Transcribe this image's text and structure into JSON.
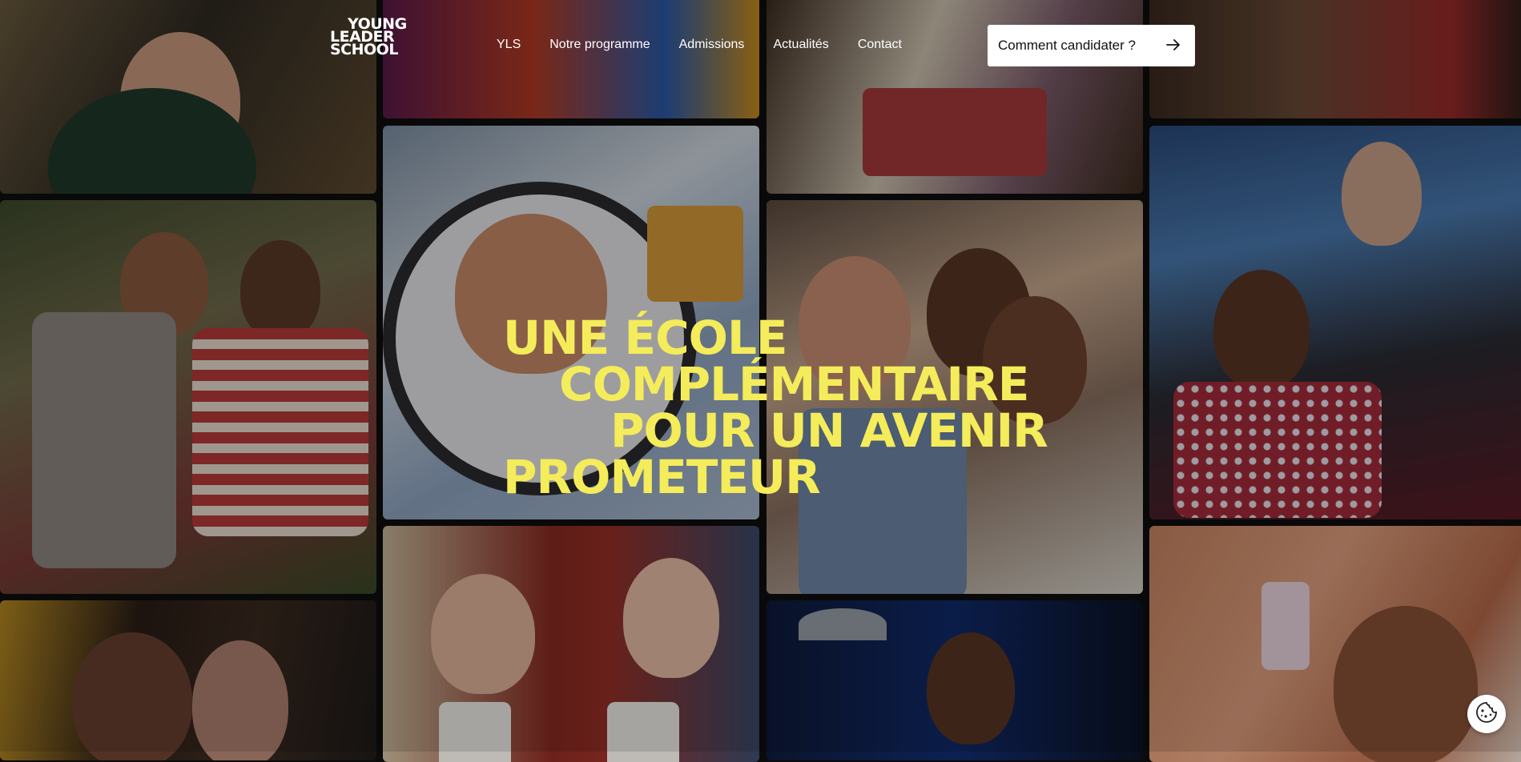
{
  "logo": {
    "line1": "YOUNG",
    "line2": "LEADER",
    "line3": "SCHOOL"
  },
  "nav": {
    "items": [
      "YLS",
      "Notre programme",
      "Admissions",
      "Actualités",
      "Contact"
    ]
  },
  "cta": {
    "label": "Comment candidater ?",
    "icon": "arrow-right-icon"
  },
  "hero": {
    "line1": "UNE ÉCOLE",
    "line2": "COMPLÉMENTAIRE",
    "line3": "POUR UN AVENIR",
    "line4": "PROMETEUR"
  },
  "colors": {
    "accent": "#f4ec5a",
    "cta_bg": "#ffffff",
    "text_light": "#ffffff"
  },
  "cookie": {
    "icon": "cookie-icon"
  }
}
